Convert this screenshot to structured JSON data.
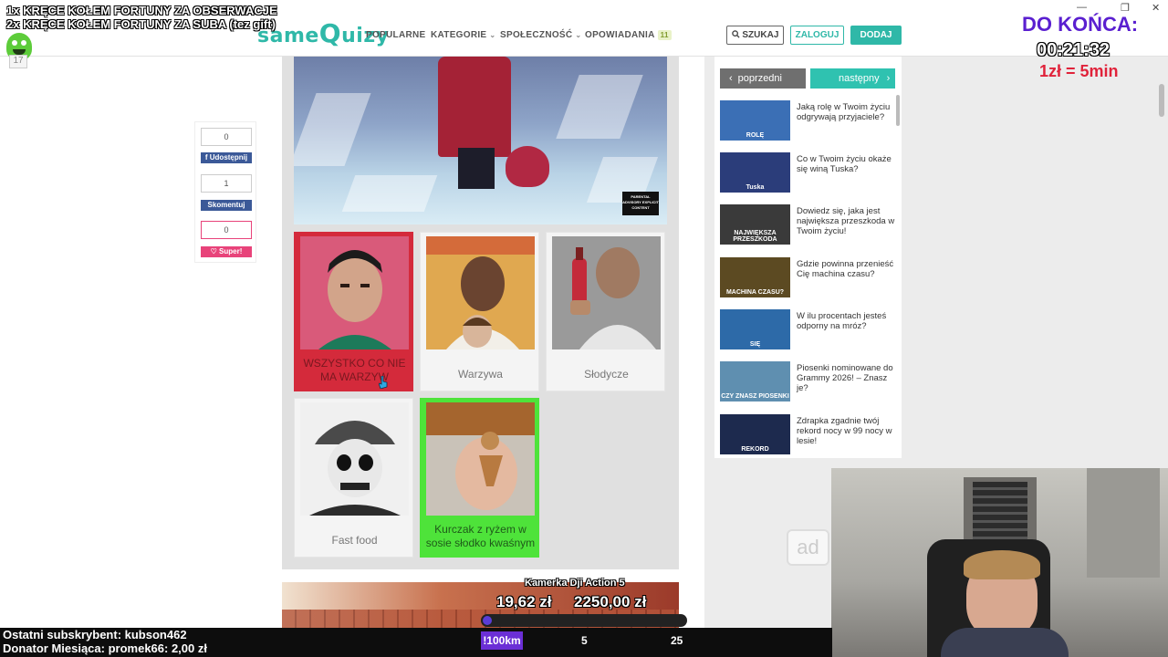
{
  "overlay": {
    "line1": "1x KRĘCE KOŁEM FORTUNY ZA OBSERWACJE",
    "line2": "2x KRĘCE KOŁEM FORTUNY ZA SUBA (tez gift)",
    "emote_sub": "17",
    "timer_title": "DO KOŃCA:",
    "timer_value": "00:21:32",
    "timer_rate": "1zł = 5min",
    "last_sub": "Ostatni subskrybent: kubson462",
    "donor": "Donator Miesiąca: promek66: 2,00 zł",
    "km_label": "!100km",
    "km_tick1": "5",
    "km_tick2": "25",
    "promo_title": "Kamerka Dji Action 5",
    "promo_current": "19,62 zł",
    "promo_goal": "2250,00 zł",
    "promo_progress": 0.0087,
    "ad": "ad"
  },
  "site": {
    "logo_same": "same",
    "logo_q": "Q",
    "logo_uizy": "uizy",
    "nav": [
      {
        "label": "POPULARNE",
        "caret": ""
      },
      {
        "label": "KATEGORIE",
        "caret": "⌄"
      },
      {
        "label": "SPOŁECZNOŚĆ",
        "caret": "⌄"
      },
      {
        "label": "OPOWIADANIA",
        "caret": "",
        "count": "11"
      }
    ],
    "search": "SZUKAJ",
    "login": "ZALOGUJ",
    "add": "DODAJ"
  },
  "share": {
    "share_count": "0",
    "share_label": "Udostępnij",
    "comment_count": "1",
    "comment_label": "Skomentuj",
    "super_count": "0",
    "super_label": "Super!"
  },
  "hero": {
    "advisory": "PARENTAL ADVISORY EXPLICIT CONTENT"
  },
  "answers": [
    {
      "label": "WSZYSTKO CO NIE MA WARZYW",
      "state": "selected-wrong"
    },
    {
      "label": "Warzywa",
      "state": "normal"
    },
    {
      "label": "Słodycze",
      "state": "normal"
    },
    {
      "label": "Fast food",
      "state": "normal"
    },
    {
      "label": "Kurczak z ryżem w sosie słodko kwaśnym",
      "state": "correct"
    }
  ],
  "sidebar": {
    "prev": "poprzedni",
    "next": "następny",
    "items": [
      {
        "title": "Jaką rolę w Twoim życiu odgrywają przyjaciele?",
        "thumb": "ROLĘ",
        "color": "#3b6fb5"
      },
      {
        "title": "Co w Twoim życiu okaże się winą Tuska?",
        "thumb": "Tuska",
        "color": "#2b3d7a"
      },
      {
        "title": "Dowiedz się, jaka jest największa przeszkoda w Twoim życiu!",
        "thumb": "NAJWIĘKSZA PRZESZKODA",
        "color": "#3a3a3a"
      },
      {
        "title": "Gdzie powinna przenieść Cię machina czasu?",
        "thumb": "MACHINA CZASU?",
        "color": "#5c4a22"
      },
      {
        "title": "W ilu procentach jesteś odporny na mróz?",
        "thumb": "SIĘ",
        "color": "#2d6aa8"
      },
      {
        "title": "Piosenki nominowane do Grammy 2026! – Znasz je?",
        "thumb": "CZY ZNASZ PIOSENKI",
        "color": "#5f8fb0"
      },
      {
        "title": "Zdrapka zgadnie twój rekord nocy w 99 nocy w lesie!",
        "thumb": "REKORD",
        "color": "#1d2a4e"
      }
    ]
  }
}
